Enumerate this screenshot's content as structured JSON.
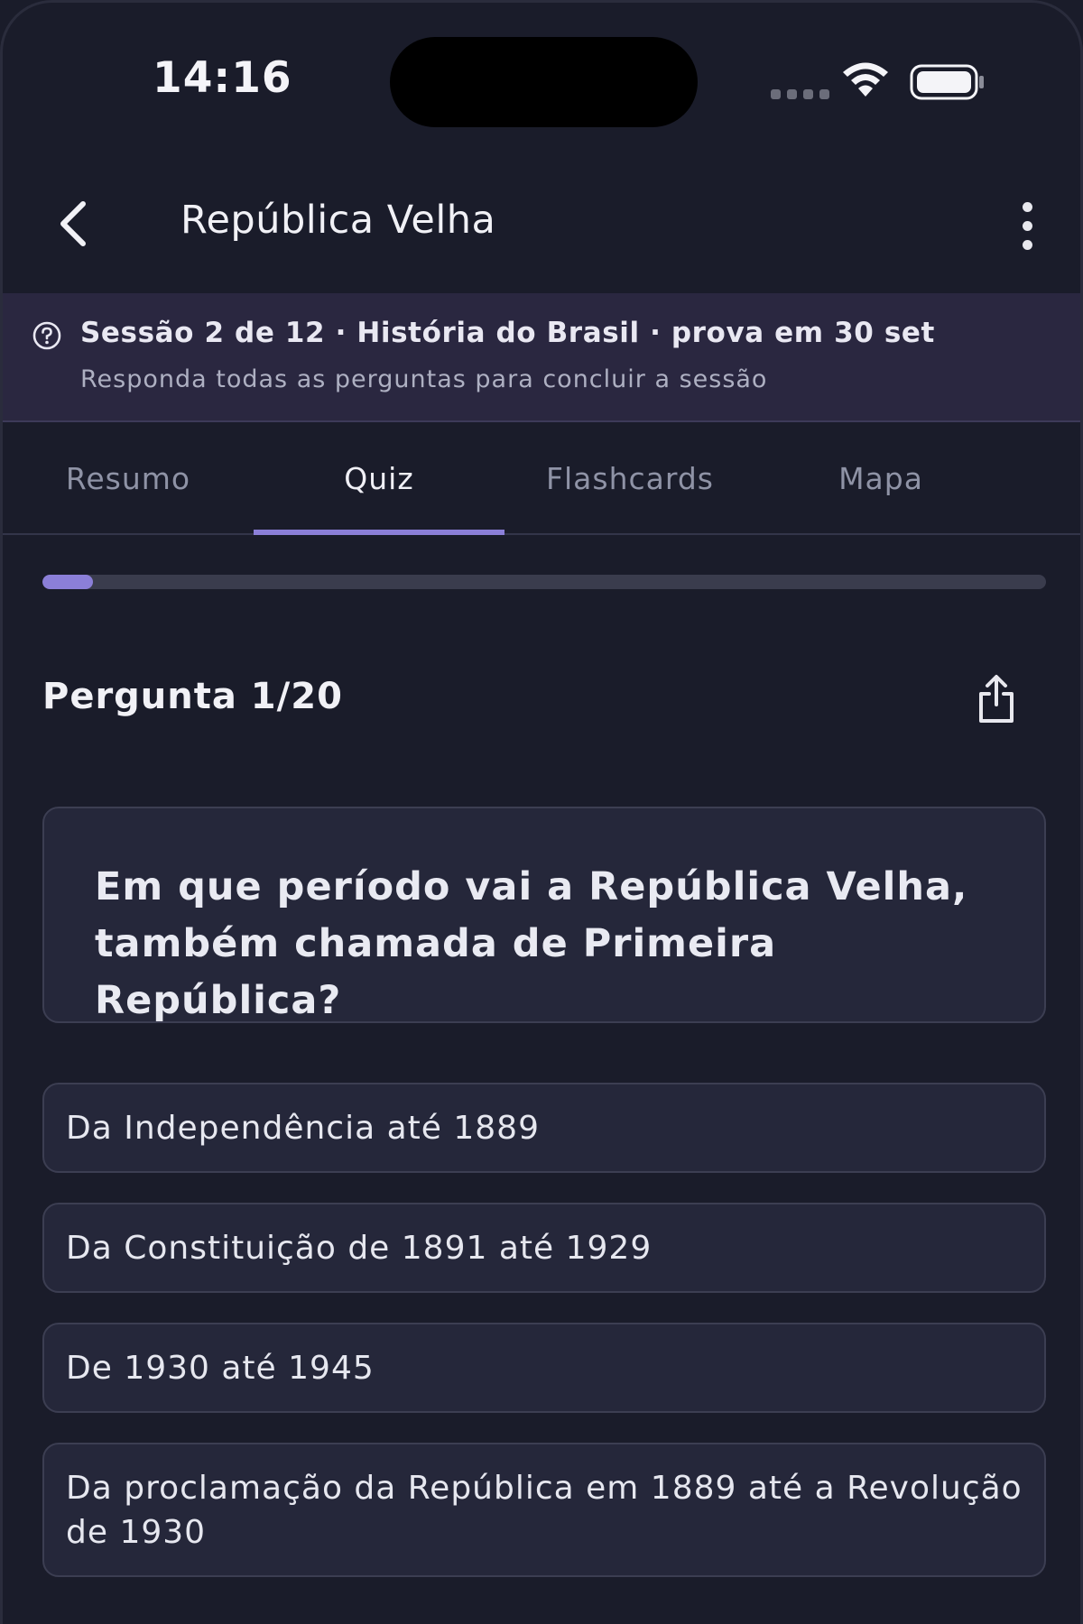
{
  "status_bar": {
    "time": "14:16"
  },
  "header": {
    "title": "República Velha"
  },
  "session": {
    "title": "Sessão 2 de 12 · História do Brasil · prova em 30 set",
    "subtitle": "Responda todas as perguntas para concluir a sessão"
  },
  "tabs": [
    {
      "label": "Resumo",
      "active": false
    },
    {
      "label": "Quiz",
      "active": true
    },
    {
      "label": "Flashcards",
      "active": false
    },
    {
      "label": "Mapa",
      "active": false
    }
  ],
  "progress": {
    "fraction": 0.05
  },
  "quiz": {
    "counter": "Pergunta 1/20",
    "question": "Em que período vai a República Velha, também chamada de Primeira República?",
    "options": [
      "Da Independência até 1889",
      "Da Constituição de 1891 até 1929",
      "De 1930 até 1945",
      "Da proclamação da República em 1889 até a Revolução de 1930"
    ]
  },
  "colors": {
    "accent": "#8b7fd8",
    "background": "#1a1c2a",
    "card": "#25273a",
    "banner": "#2a2740"
  },
  "icons": [
    "back-arrow-icon",
    "more-vertical-icon",
    "help-circle-icon",
    "share-icon",
    "wifi-icon",
    "battery-icon",
    "signal-icon"
  ]
}
